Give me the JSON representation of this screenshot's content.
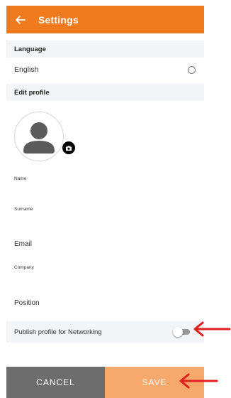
{
  "appbar": {
    "title": "Settings"
  },
  "language_section": {
    "title": "Language",
    "selected_label": "English"
  },
  "edit_profile_section": {
    "title": "Edit profile"
  },
  "fields": {
    "name": "Name",
    "surname": "Surname",
    "email": "Email",
    "company": "Company",
    "position": "Position"
  },
  "publish": {
    "label": "Publish profile for Networking",
    "enabled": false
  },
  "buttons": {
    "cancel": "CANCEL",
    "save": "SAVE"
  },
  "colors": {
    "appbar": "#f07b1e",
    "section_bg": "#f3f4f8",
    "cancel_bg": "#6d6d6d",
    "save_bg": "#f7a86c",
    "annotation_arrow": "#e02020"
  },
  "icons": {
    "back": "arrow-left-icon",
    "avatar": "user-avatar-icon",
    "camera": "camera-icon",
    "annotation": "red-arrow-icon"
  }
}
